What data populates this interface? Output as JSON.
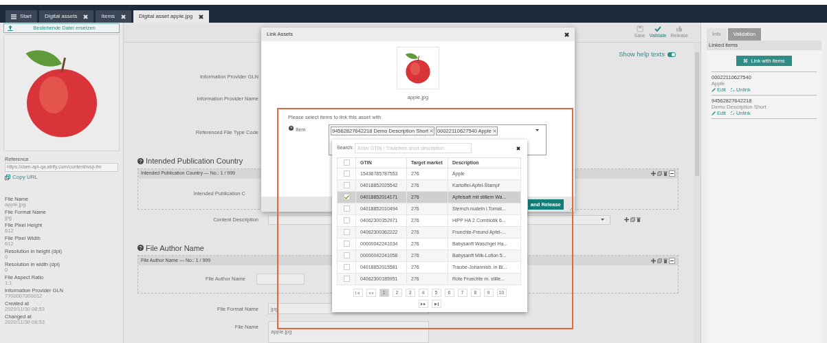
{
  "tabs": [
    {
      "label": "Start",
      "kind": "home",
      "selected": false
    },
    {
      "label": "Digital assets",
      "kind": "closable",
      "selected": false
    },
    {
      "label": "Items",
      "kind": "closable",
      "selected": false
    },
    {
      "label": "Digital asset apple.jpg",
      "kind": "closable",
      "selected": true
    }
  ],
  "left_panel": {
    "replace_button": "Bestehende Datei ersetzen",
    "reference_label": "Reference",
    "reference_value": "https://dam-api-qa.atrify.com/content/wsp-fm",
    "copy_url": "Copy URL",
    "properties": [
      {
        "label": "File Name",
        "value": "apple.jpg"
      },
      {
        "label": "File Format Name",
        "value": "jpg"
      },
      {
        "label": "File Pixel Height",
        "value": "612"
      },
      {
        "label": "File Pixel Width",
        "value": "612"
      },
      {
        "label": "Resolution in height (dpi)",
        "value": "0"
      },
      {
        "label": "Resolution in width (dpi)",
        "value": "0"
      },
      {
        "label": "File Aspect Ratio",
        "value": "1:1"
      },
      {
        "label": "Information Provider GLN",
        "value": "7700007000012"
      },
      {
        "label": "Created at",
        "value": "2020/11/30 08:53"
      },
      {
        "label": "Changed at",
        "value": "2020/11/30 08:53"
      }
    ]
  },
  "toolbar": [
    {
      "label": "Save",
      "kind": "save",
      "disabled": true
    },
    {
      "label": "Validate",
      "kind": "validate",
      "disabled": false
    },
    {
      "label": "Release",
      "kind": "release",
      "disabled": true
    }
  ],
  "help_toggle": {
    "label": "Show help texts",
    "on": true
  },
  "form": {
    "top_labels": [
      "Information Provider GLN",
      "Information Provider Name",
      "Referenced File Type Code"
    ],
    "country_section": {
      "title": "Intended Publication Country",
      "group_header": "Intended Publication Country — No.: 1 / 999",
      "field_label": "Intended Publication C"
    },
    "content_description_label": "Content Description",
    "author_section": {
      "title": "File Author Name",
      "group_header": "File Author Name — No.: 1 / 999",
      "field_label": "File Author Name"
    },
    "file_format": {
      "label": "File Format Name",
      "value": "jpg"
    },
    "file_name": {
      "label": "File Name",
      "value": "apple.jpg"
    }
  },
  "modal": {
    "title": "Link Assets",
    "image_caption": "apple.jpg",
    "prompt": "Please select items to link this asset with",
    "item_label": "Item",
    "tags": [
      "94562827642218 Demo Description Short",
      "00022110627540 Apple"
    ],
    "release_button": "and Release"
  },
  "dropdown": {
    "search_label": "Search:",
    "search_placeholder": "Enter GTIN / Tradeitem short description",
    "header_checked": false,
    "columns": [
      "GTIN",
      "Target market",
      "Description"
    ],
    "rows": [
      {
        "gtin": "15436785787553",
        "market": "276",
        "description": "Apple",
        "checked": false,
        "selected": false
      },
      {
        "gtin": "04018852025542",
        "market": "276",
        "description": "Kartoffel-Apfel-Stampf",
        "checked": false,
        "selected": false
      },
      {
        "gtin": "04018852014171",
        "market": "276",
        "description": "Apfelsaft mit stillem Wa...",
        "checked": true,
        "selected": true
      },
      {
        "gtin": "04018852010494",
        "market": "276",
        "description": "Sternch.nudeln i.Tomat...",
        "checked": false,
        "selected": false
      },
      {
        "gtin": "04062300352971",
        "market": "276",
        "description": "HiPP HA 2 Combiotik 6...",
        "checked": false,
        "selected": false
      },
      {
        "gtin": "04062300362222",
        "market": "276",
        "description": "Fruechte-Freund Apfel-...",
        "checked": false,
        "selected": false
      },
      {
        "gtin": "00000042241034",
        "market": "276",
        "description": "Babysanft Waschgel Ha...",
        "checked": false,
        "selected": false
      },
      {
        "gtin": "00000042241058",
        "market": "276",
        "description": "Babysanft Milk-Lotion 5...",
        "checked": false,
        "selected": false
      },
      {
        "gtin": "04018852015581",
        "market": "276",
        "description": "Traube-Johannisb. in Bi...",
        "checked": false,
        "selected": false
      },
      {
        "gtin": "04062300185951",
        "market": "276",
        "description": "Rote Fruechte m. stille...",
        "checked": false,
        "selected": false
      }
    ],
    "pages": [
      {
        "label": "1",
        "selected": true
      },
      {
        "label": "2",
        "selected": false
      },
      {
        "label": "3",
        "selected": false
      },
      {
        "label": "4",
        "selected": false
      },
      {
        "label": "5",
        "selected": false
      },
      {
        "label": "6",
        "selected": false
      },
      {
        "label": "7",
        "selected": false
      },
      {
        "label": "8",
        "selected": false
      },
      {
        "label": "9",
        "selected": false
      },
      {
        "label": "10",
        "selected": false
      }
    ]
  },
  "right_panel": {
    "tabs": [
      {
        "label": "Info",
        "selected": false
      },
      {
        "label": "Validation",
        "selected": true
      }
    ],
    "section_title": "Linked items",
    "link_button": "Link with items",
    "linked": [
      {
        "gtin": "00022110627540",
        "name": "Apple",
        "edit": "Edit",
        "unlink": "Unlink"
      },
      {
        "gtin": "94562827642218",
        "name": "Demo Description Short",
        "edit": "Edit",
        "unlink": "Unlink"
      }
    ]
  }
}
